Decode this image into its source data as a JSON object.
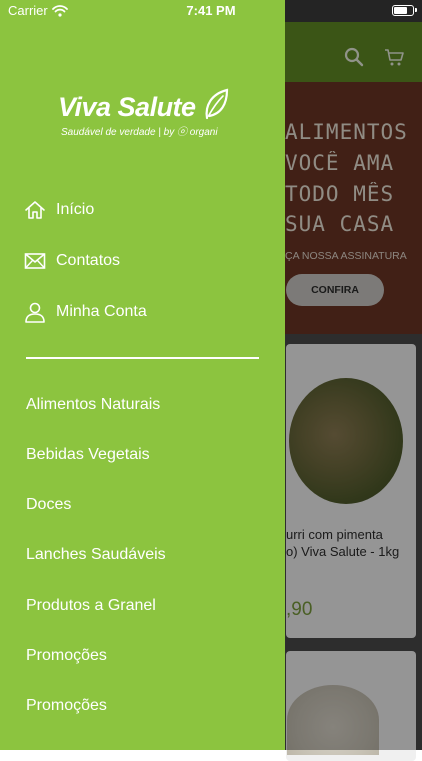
{
  "status_bar": {
    "carrier": "Carrier",
    "time": "7:41 PM"
  },
  "brand": {
    "name": "Viva Salute",
    "tagline": "Saudável de verdade | by ⓞ organi"
  },
  "drawer": {
    "nav": [
      {
        "label": "Início",
        "icon": "home-icon"
      },
      {
        "label": "Contatos",
        "icon": "mail-icon"
      },
      {
        "label": "Minha Conta",
        "icon": "user-icon"
      }
    ],
    "categories": [
      {
        "label": "Alimentos Naturais"
      },
      {
        "label": "Bebidas Vegetais"
      },
      {
        "label": "Doces"
      },
      {
        "label": "Lanches Saudáveis"
      },
      {
        "label": "Produtos a Granel"
      },
      {
        "label": "Promoções"
      },
      {
        "label": "Promoções"
      }
    ]
  },
  "background": {
    "header_icons": [
      "search-icon",
      "cart-icon"
    ],
    "banner": {
      "lines": [
        "ALIMENTOS",
        "VOCÊ AMA",
        "TODO MÊS",
        "SUA CASA"
      ],
      "subtitle": "ÇA NOSSA ASSINATURA",
      "button": "CONFIRA"
    },
    "product": {
      "title_line1": "urri com pimenta",
      "title_line2": "o) Viva Salute - 1kg",
      "price": ",90"
    }
  },
  "colors": {
    "drawer_bg": "#8cc43f",
    "banner_bg": "#6a3524",
    "price": "#789a3c"
  }
}
